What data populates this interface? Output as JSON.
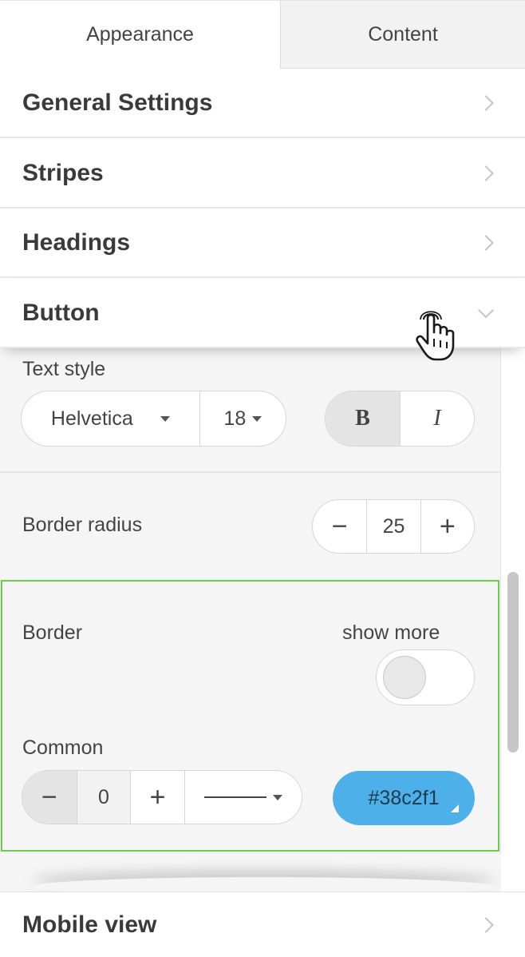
{
  "tabs": [
    {
      "label": "Appearance",
      "active": true
    },
    {
      "label": "Content",
      "active": false
    }
  ],
  "sections": {
    "general": "General Settings",
    "stripes": "Stripes",
    "headings": "Headings",
    "button": "Button",
    "mobile": "Mobile view"
  },
  "button_settings": {
    "text_style_label": "Text style",
    "font_value": "Helvetica",
    "size_value": "18",
    "bold_label": "B",
    "italic_label": "I",
    "border_radius_label": "Border radius",
    "border_radius_minus": "−",
    "border_radius_value": "25",
    "border_radius_plus": "+",
    "border_label": "Border",
    "show_more_label": "show more",
    "show_more_enabled": false,
    "common_label": "Common",
    "border_width_minus": "−",
    "border_width_value": "0",
    "border_width_plus": "+",
    "border_color_value": "#38c2f1"
  },
  "colors": {
    "border_highlight": "#6ccc4c",
    "color_swatch": "#4db0e8"
  },
  "icons": {
    "chevron": "chevron-right-icon",
    "chevron_open": "chevron-down-icon",
    "cursor": "hand-pointer-icon",
    "line_style": "solid-line-icon"
  }
}
